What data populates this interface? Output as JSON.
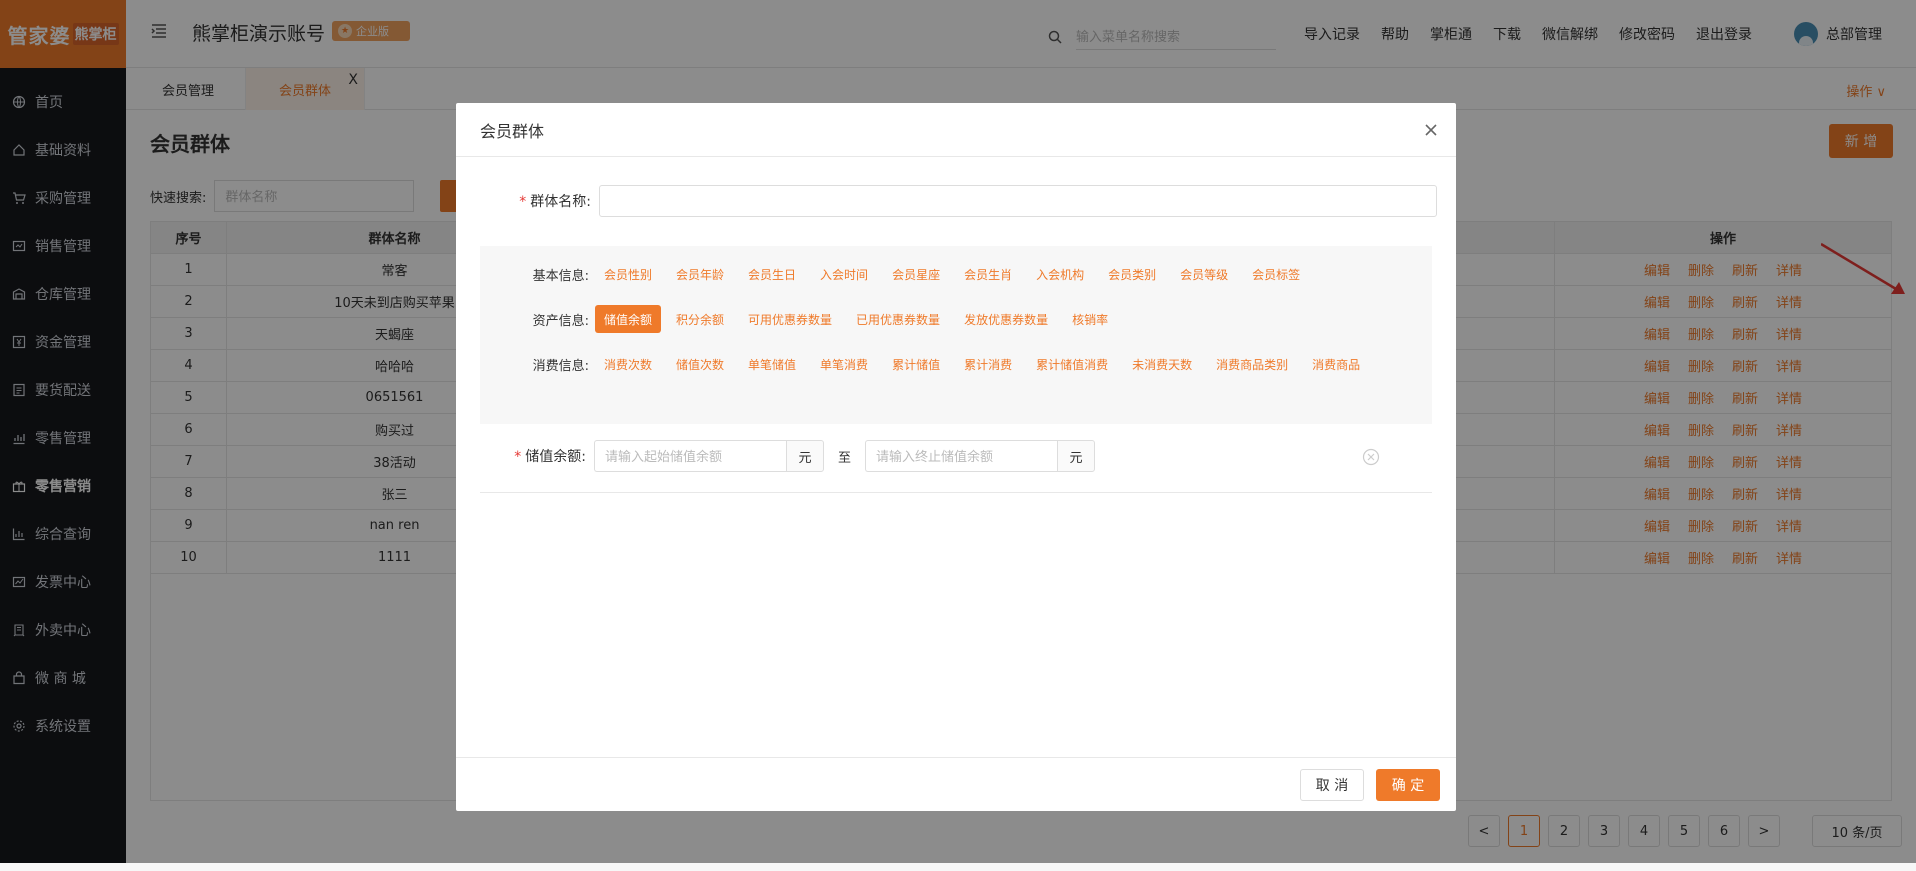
{
  "brand": {
    "logo_main": "管家婆",
    "logo_sub": "熊掌柜"
  },
  "sidebar": {
    "items": [
      {
        "label": "首页",
        "icon": "globe-icon"
      },
      {
        "label": "基础资料",
        "icon": "home-icon"
      },
      {
        "label": "采购管理",
        "icon": "cart-icon"
      },
      {
        "label": "销售管理",
        "icon": "sales-icon"
      },
      {
        "label": "仓库管理",
        "icon": "warehouse-icon"
      },
      {
        "label": "资金管理",
        "icon": "money-icon"
      },
      {
        "label": "要货配送",
        "icon": "delivery-icon"
      },
      {
        "label": "零售管理",
        "icon": "chart-icon"
      },
      {
        "label": "零售营销",
        "icon": "gift-icon"
      },
      {
        "label": "综合查询",
        "icon": "bar-chart-icon"
      },
      {
        "label": "发票中心",
        "icon": "invoice-icon"
      },
      {
        "label": "外卖中心",
        "icon": "takeout-icon"
      },
      {
        "label": "微 商 城",
        "icon": "shop-icon"
      },
      {
        "label": "系统设置",
        "icon": "gear-icon"
      }
    ],
    "active_index": 8
  },
  "header": {
    "title": "熊掌柜演示账号",
    "badge": "企业版",
    "search_placeholder": "输入菜单名称搜索",
    "nav": [
      "导入记录",
      "帮助",
      "掌柜通",
      "下载",
      "微信解绑",
      "修改密码",
      "退出登录"
    ],
    "user": "总部管理"
  },
  "tabs": {
    "items": [
      "会员管理",
      "会员群体"
    ],
    "close": "X",
    "ops": "操作 ∨"
  },
  "page": {
    "title": "会员群体",
    "new_button": "新 增",
    "quick_search_label": "快速搜索:",
    "quick_search_placeholder": "群体名称"
  },
  "table": {
    "headers": [
      "序号",
      "群体名称",
      "操作"
    ],
    "rows": [
      [
        "1",
        "常客"
      ],
      [
        "2",
        "10天未到店购买苹果"
      ],
      [
        "3",
        "天蝎座"
      ],
      [
        "4",
        "哈哈哈"
      ],
      [
        "5",
        "0651561"
      ],
      [
        "6",
        "购买过"
      ],
      [
        "7",
        "38活动"
      ],
      [
        "8",
        "张三"
      ],
      [
        "9",
        "nan ren"
      ],
      [
        "10",
        "1111"
      ]
    ],
    "actions": [
      "编辑",
      "删除",
      "刷新",
      "详情"
    ]
  },
  "pager": {
    "pages": [
      "1",
      "2",
      "3",
      "4",
      "5",
      "6"
    ],
    "current": "1",
    "prev": "<",
    "next": ">",
    "page_size": "10 条/页"
  },
  "modal": {
    "title": "会员群体",
    "name_label": "群体名称:",
    "basic": {
      "label": "基本信息:",
      "chips": [
        "会员性别",
        "会员年龄",
        "会员生日",
        "入会时间",
        "会员星座",
        "会员生肖",
        "入会机构",
        "会员类别",
        "会员等级",
        "会员标签"
      ]
    },
    "asset": {
      "label": "资产信息:",
      "chips": [
        "储值余额",
        "积分余额",
        "可用优惠券数量",
        "已用优惠券数量",
        "发放优惠券数量",
        "核销率"
      ],
      "selected": "储值余额"
    },
    "consume": {
      "label": "消费信息:",
      "chips": [
        "消费次数",
        "储值次数",
        "单笔储值",
        "单笔消费",
        "累计储值",
        "累计消费",
        "累计储值消费",
        "未消费天数",
        "消费商品类别",
        "消费商品"
      ]
    },
    "range": {
      "label": "储值余额:",
      "start_placeholder": "请输入起始储值余额",
      "end_placeholder": "请输入终止储值余额",
      "unit": "元",
      "to": "至"
    },
    "cancel": "取 消",
    "confirm": "确 定"
  },
  "colors": {
    "accent": "#ef7a2a",
    "sidebar": "#16181d"
  }
}
